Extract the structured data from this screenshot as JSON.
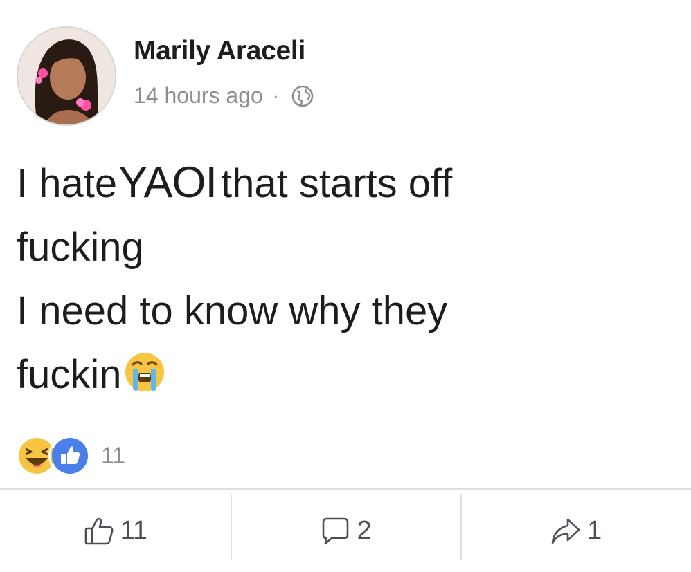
{
  "post": {
    "author": "Marily Araceli",
    "timestamp": "14 hours ago",
    "separator": "·",
    "privacy_icon": "globe-icon",
    "body": {
      "line1_before": "I hate",
      "line1_highlight": "YAOI",
      "line1_after": "that starts off",
      "line2": "fucking",
      "line3": "I need to know why they",
      "line4": "fuckin",
      "emoji": "crying-face-emoji"
    }
  },
  "reactions": {
    "icons": [
      "laughing-face-icon",
      "thumbs-up-icon"
    ],
    "count": "11"
  },
  "actions": {
    "like_count": "11",
    "comment_count": "2",
    "share_count": "1"
  },
  "colors": {
    "text": "#1d1d1d",
    "meta": "#8a8d91",
    "like_blue": "#4a7ee8",
    "haha_yellow": "#f7c542",
    "divider": "#dddfe2"
  }
}
